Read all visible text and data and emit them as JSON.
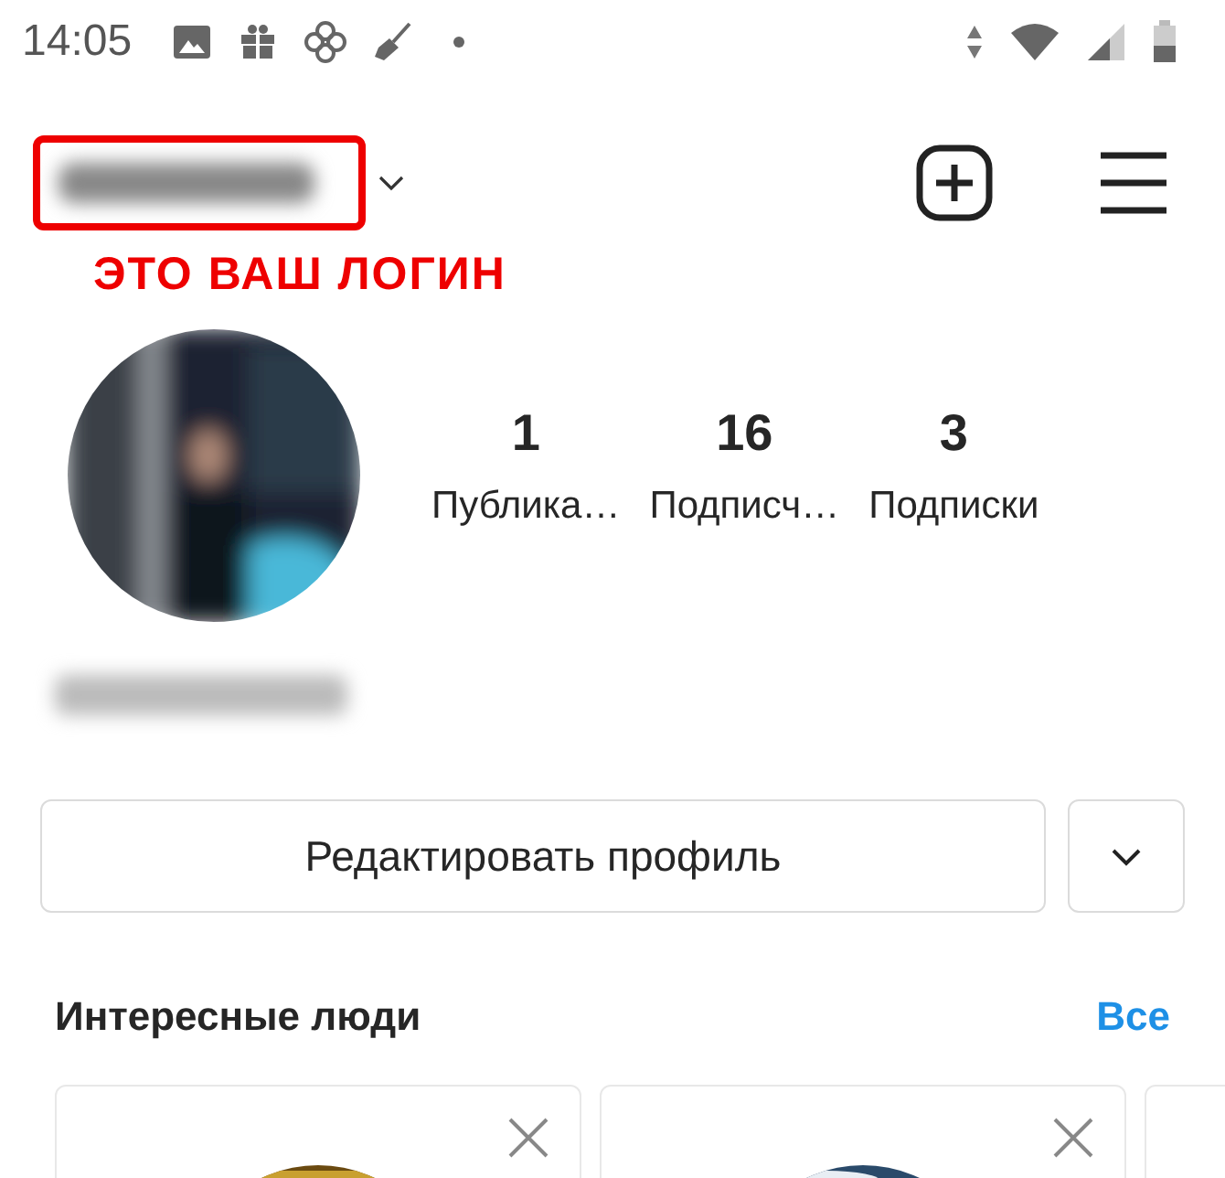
{
  "status_bar": {
    "time": "14:05"
  },
  "header": {
    "annotation": "ЭТО ВАШ ЛОГИН"
  },
  "stats": [
    {
      "value": "1",
      "label": "Публика…"
    },
    {
      "value": "16",
      "label": "Подписч…"
    },
    {
      "value": "3",
      "label": "Подписки"
    }
  ],
  "edit_button": "Редактировать профиль",
  "suggested": {
    "title": "Интересные люди",
    "see_all": "Все",
    "cards": [
      {
        "kind": "picture",
        "dismissible": true
      },
      {
        "kind": "picture",
        "dismissible": true
      },
      {
        "kind": "edge"
      }
    ]
  }
}
